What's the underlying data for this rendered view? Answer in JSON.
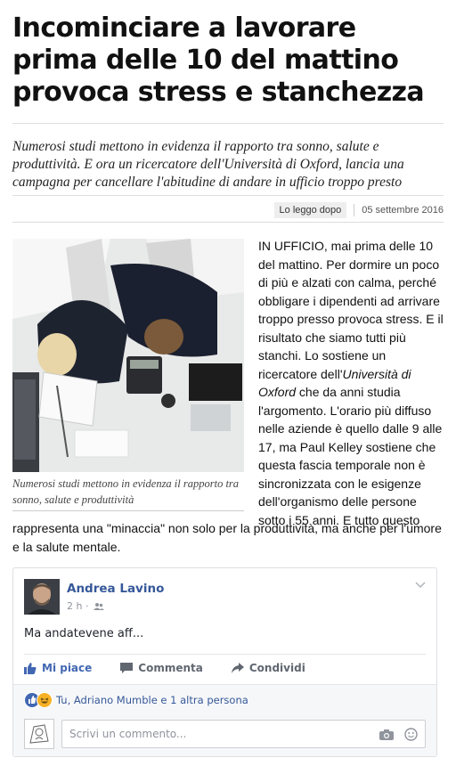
{
  "article": {
    "title": "Incominciare a lavorare prima delle 10 del mattino provoca stress e stanchezza",
    "subtitle": "Numerosi studi mettono in evidenza il rapporto tra sonno, salute e produttività. E ora un ricercatore dell'Università di Oxford, lancia una campagna per cancellare l'abitudine di andare in ufficio troppo presto",
    "read_later": "Lo leggo dopo",
    "date": "05 settembre 2016",
    "caption": "Numerosi studi mettono in evidenza il rapporto tra sonno, salute e produttività",
    "body": {
      "p1": "IN UFFICIO, mai prima delle 10 del mattino. Per dormire un poco di più e alzati con calma, perché obbligare i dipendenti ad arrivare troppo presso provoca stress. E il risultato che siamo tutti più stanchi. Lo sostiene un ricercatore dell'",
      "p1_italic": "Università di Oxford",
      "p1_rest": " che da anni studia l'argomento. L'orario più diffuso nelle aziende è quello dalle 9 alle 17, ma Paul Kelley sostiene che questa fascia temporale non è sincronizzata con le esigenze dell'organismo delle persone sotto i 55 anni. E tutto questo",
      "p2": "rappresenta una \"minaccia\" non solo per la produttività, ma anche per l'umore e la salute mentale."
    }
  },
  "facebook": {
    "author": "Andrea Lavino",
    "time": "2 h ·",
    "post": "Ma andatevene aff...",
    "actions": {
      "like": "Mi piace",
      "comment": "Commenta",
      "share": "Condividi"
    },
    "reactions": "Tu, Adriano Mumble e 1 altra persona",
    "comment_placeholder": "Scrivi un commento...",
    "colors": {
      "link": "#365899",
      "like": "#4267b2"
    }
  }
}
